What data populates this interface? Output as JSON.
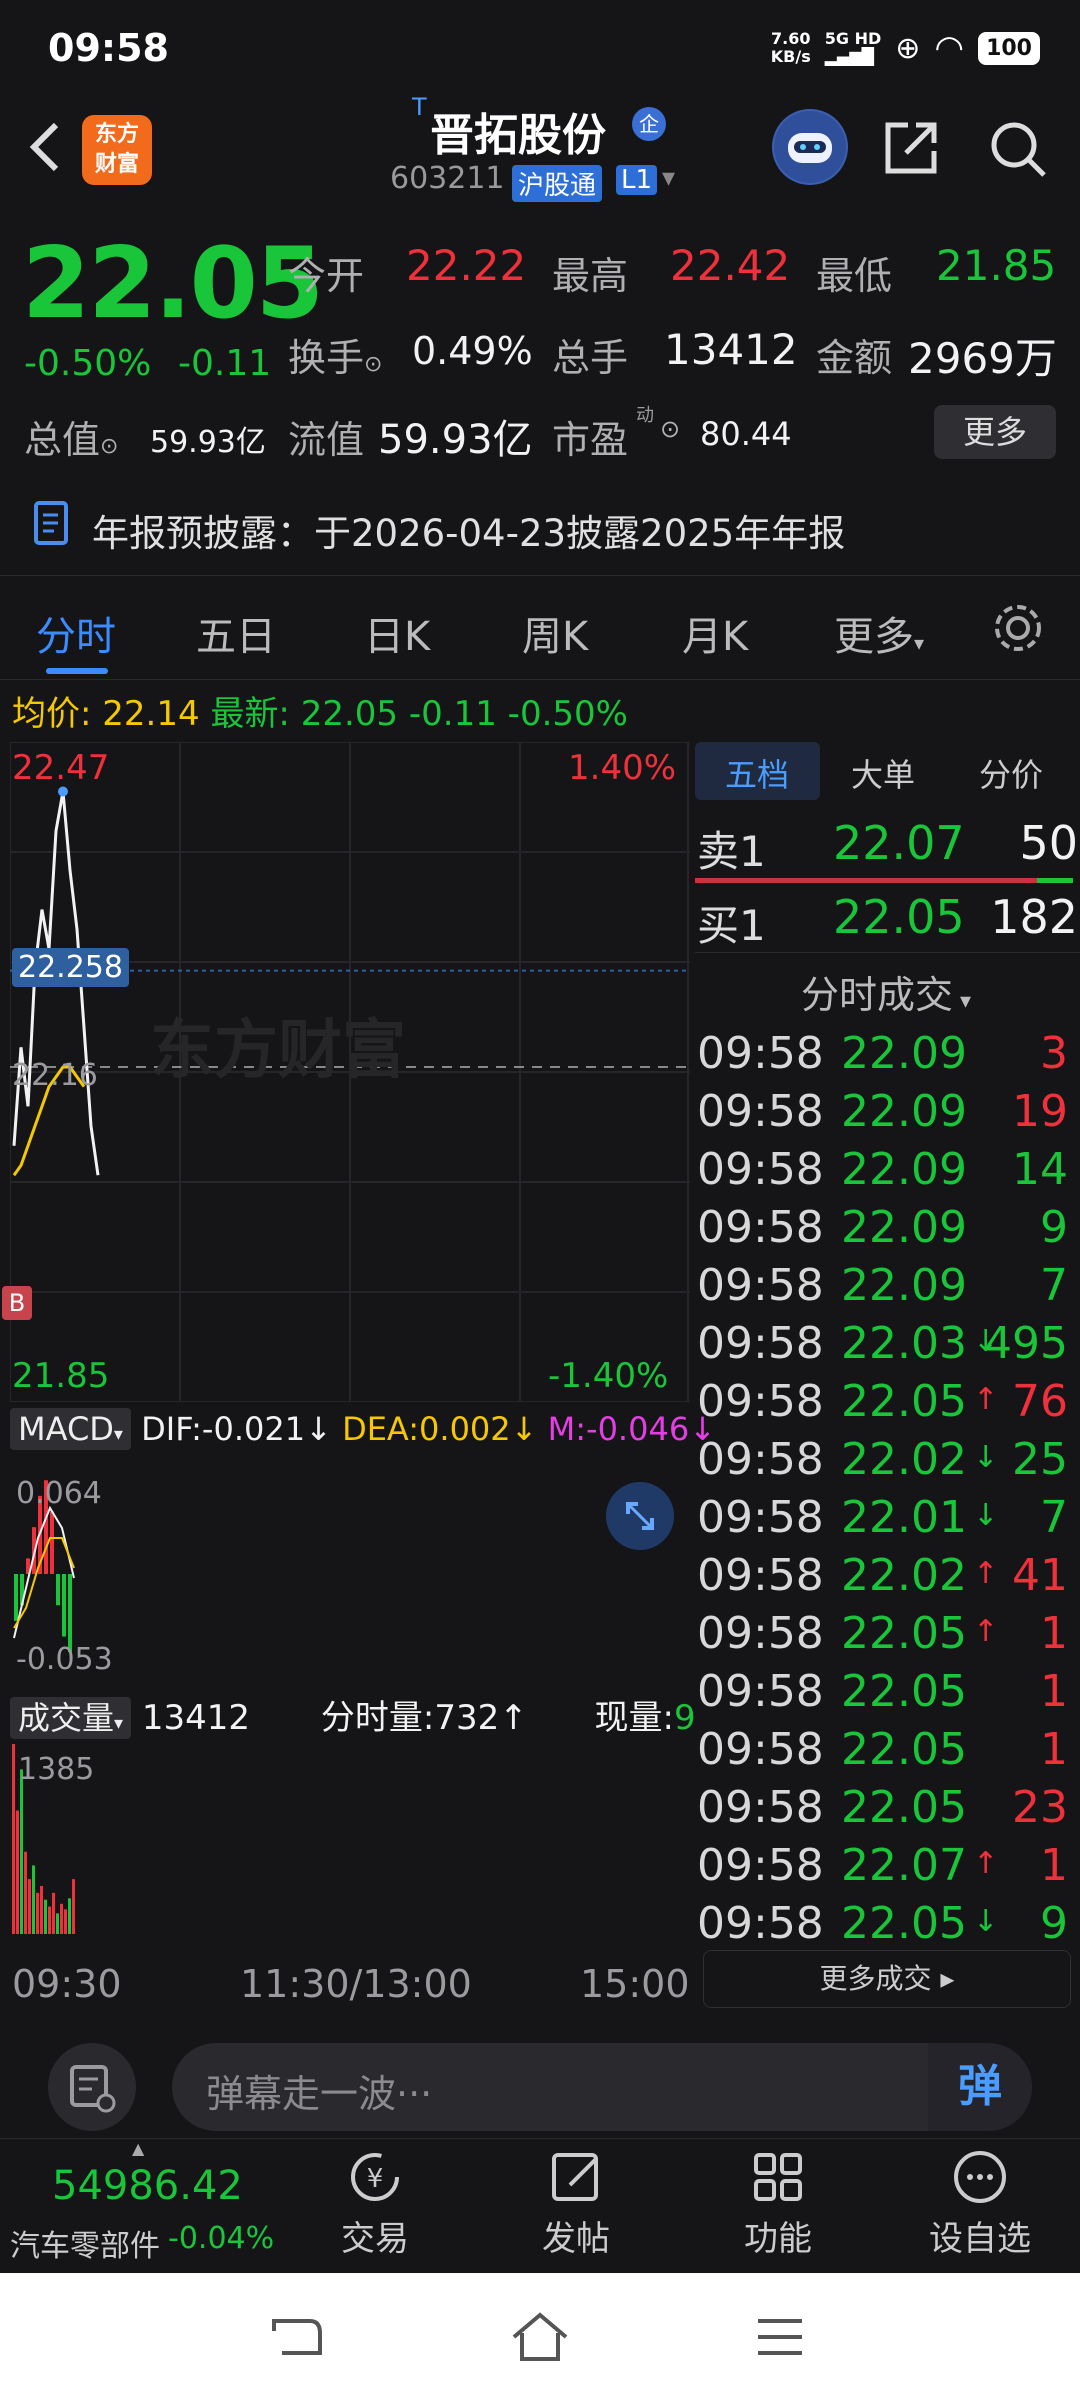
{
  "status": {
    "time": "09:58",
    "net_speed": "7.60",
    "net_unit": "KB/s",
    "net_type": "5G HD",
    "battery": "100"
  },
  "header": {
    "name": "晋拓股份",
    "superscript": "T",
    "badge": "企",
    "code": "603211",
    "tag_connect": "沪股通",
    "tag_level": "L1",
    "logo_line1": "东方",
    "logo_line2": "财富"
  },
  "quote": {
    "price": "22.05",
    "change_pct": "-0.50%",
    "change": "-0.11",
    "open_label": "今开",
    "open": "22.22",
    "high_label": "最高",
    "high": "22.42",
    "low_label": "最低",
    "low": "21.85",
    "turnover_label": "换手",
    "turnover": "0.49%",
    "volume_label": "总手",
    "volume": "13412",
    "amount_label": "金额",
    "amount": "2969万",
    "mktcap_label": "总值",
    "mktcap": "59.93亿",
    "float_label": "流值",
    "float_cap": "59.93亿",
    "pe_label": "市盈",
    "pe_sup": "动",
    "pe": "80.44",
    "more": "更多"
  },
  "notice": "年报预披露：于2026-04-23披露2025年年报",
  "tabs": [
    "分时",
    "五日",
    "日K",
    "周K",
    "月K",
    "更多"
  ],
  "infoline": {
    "avg_label": "均价:",
    "avg": "22.14",
    "latest_label": "最新:",
    "latest": "22.05",
    "chg": "-0.11",
    "pct": "-0.50%"
  },
  "chart": {
    "y_top": "22.47",
    "y_bottom": "21.85",
    "pct_top": "1.40%",
    "pct_bottom": "-1.40%",
    "marker_price": "22.258",
    "ref_price": "22.16",
    "buy_marker": "B",
    "watermark": "东方财富",
    "macd_label": "MACD",
    "dif": "DIF:-0.021↓",
    "dea": "DEA:0.002↓",
    "m": "M:-0.046↓",
    "macd_top": "0.064",
    "macd_bottom": "-0.053",
    "vol_label": "成交量",
    "vol_total": "13412",
    "vol_min_label": "分时量:",
    "vol_min": "732↑",
    "vol_now_label": "现量:",
    "vol_now": "9",
    "vol_max": "1385",
    "x_labels": [
      "09:30",
      "11:30/13:00",
      "15:00"
    ],
    "price_series": [
      22.08,
      22.18,
      22.12,
      22.26,
      22.32,
      22.28,
      22.4,
      22.44,
      22.36,
      22.3,
      22.2,
      22.1,
      22.05
    ],
    "avg_series": [
      22.05,
      22.06,
      22.08,
      22.1,
      22.12,
      22.14,
      22.15,
      22.16,
      22.16,
      22.15,
      22.14
    ]
  },
  "book": {
    "tabs": [
      "五档",
      "大单",
      "分价"
    ],
    "sell_label": "卖1",
    "sell_price": "22.07",
    "sell_vol": "50",
    "buy_label": "买1",
    "buy_price": "22.05",
    "buy_vol": "182",
    "trades_title": "分时成交",
    "more_trades": "更多成交"
  },
  "trades": [
    {
      "t": "09:58",
      "p": "22.09",
      "a": "",
      "v": "3",
      "vc": "red"
    },
    {
      "t": "09:58",
      "p": "22.09",
      "a": "",
      "v": "19",
      "vc": "red"
    },
    {
      "t": "09:58",
      "p": "22.09",
      "a": "",
      "v": "14",
      "vc": "green"
    },
    {
      "t": "09:58",
      "p": "22.09",
      "a": "",
      "v": "9",
      "vc": "green"
    },
    {
      "t": "09:58",
      "p": "22.09",
      "a": "",
      "v": "7",
      "vc": "green"
    },
    {
      "t": "09:58",
      "p": "22.03",
      "a": "↓",
      "v": "495",
      "vc": "green"
    },
    {
      "t": "09:58",
      "p": "22.05",
      "a": "↑",
      "v": "76",
      "vc": "red"
    },
    {
      "t": "09:58",
      "p": "22.02",
      "a": "↓",
      "v": "25",
      "vc": "green"
    },
    {
      "t": "09:58",
      "p": "22.01",
      "a": "↓",
      "v": "7",
      "vc": "green"
    },
    {
      "t": "09:58",
      "p": "22.02",
      "a": "↑",
      "v": "41",
      "vc": "red"
    },
    {
      "t": "09:58",
      "p": "22.05",
      "a": "↑",
      "v": "1",
      "vc": "red"
    },
    {
      "t": "09:58",
      "p": "22.05",
      "a": "",
      "v": "1",
      "vc": "red"
    },
    {
      "t": "09:58",
      "p": "22.05",
      "a": "",
      "v": "1",
      "vc": "red"
    },
    {
      "t": "09:58",
      "p": "22.05",
      "a": "",
      "v": "23",
      "vc": "red"
    },
    {
      "t": "09:58",
      "p": "22.07",
      "a": "↑",
      "v": "1",
      "vc": "red"
    },
    {
      "t": "09:58",
      "p": "22.05",
      "a": "↓",
      "v": "9",
      "vc": "green"
    }
  ],
  "comment": {
    "placeholder": "弹幕走一波···",
    "danmu": "弹"
  },
  "toolbar": {
    "index_value": "54986.42",
    "index_name": "汽车零部件",
    "index_pct": "-0.04%",
    "trade": "交易",
    "post": "发帖",
    "func": "功能",
    "watch": "设自选"
  }
}
